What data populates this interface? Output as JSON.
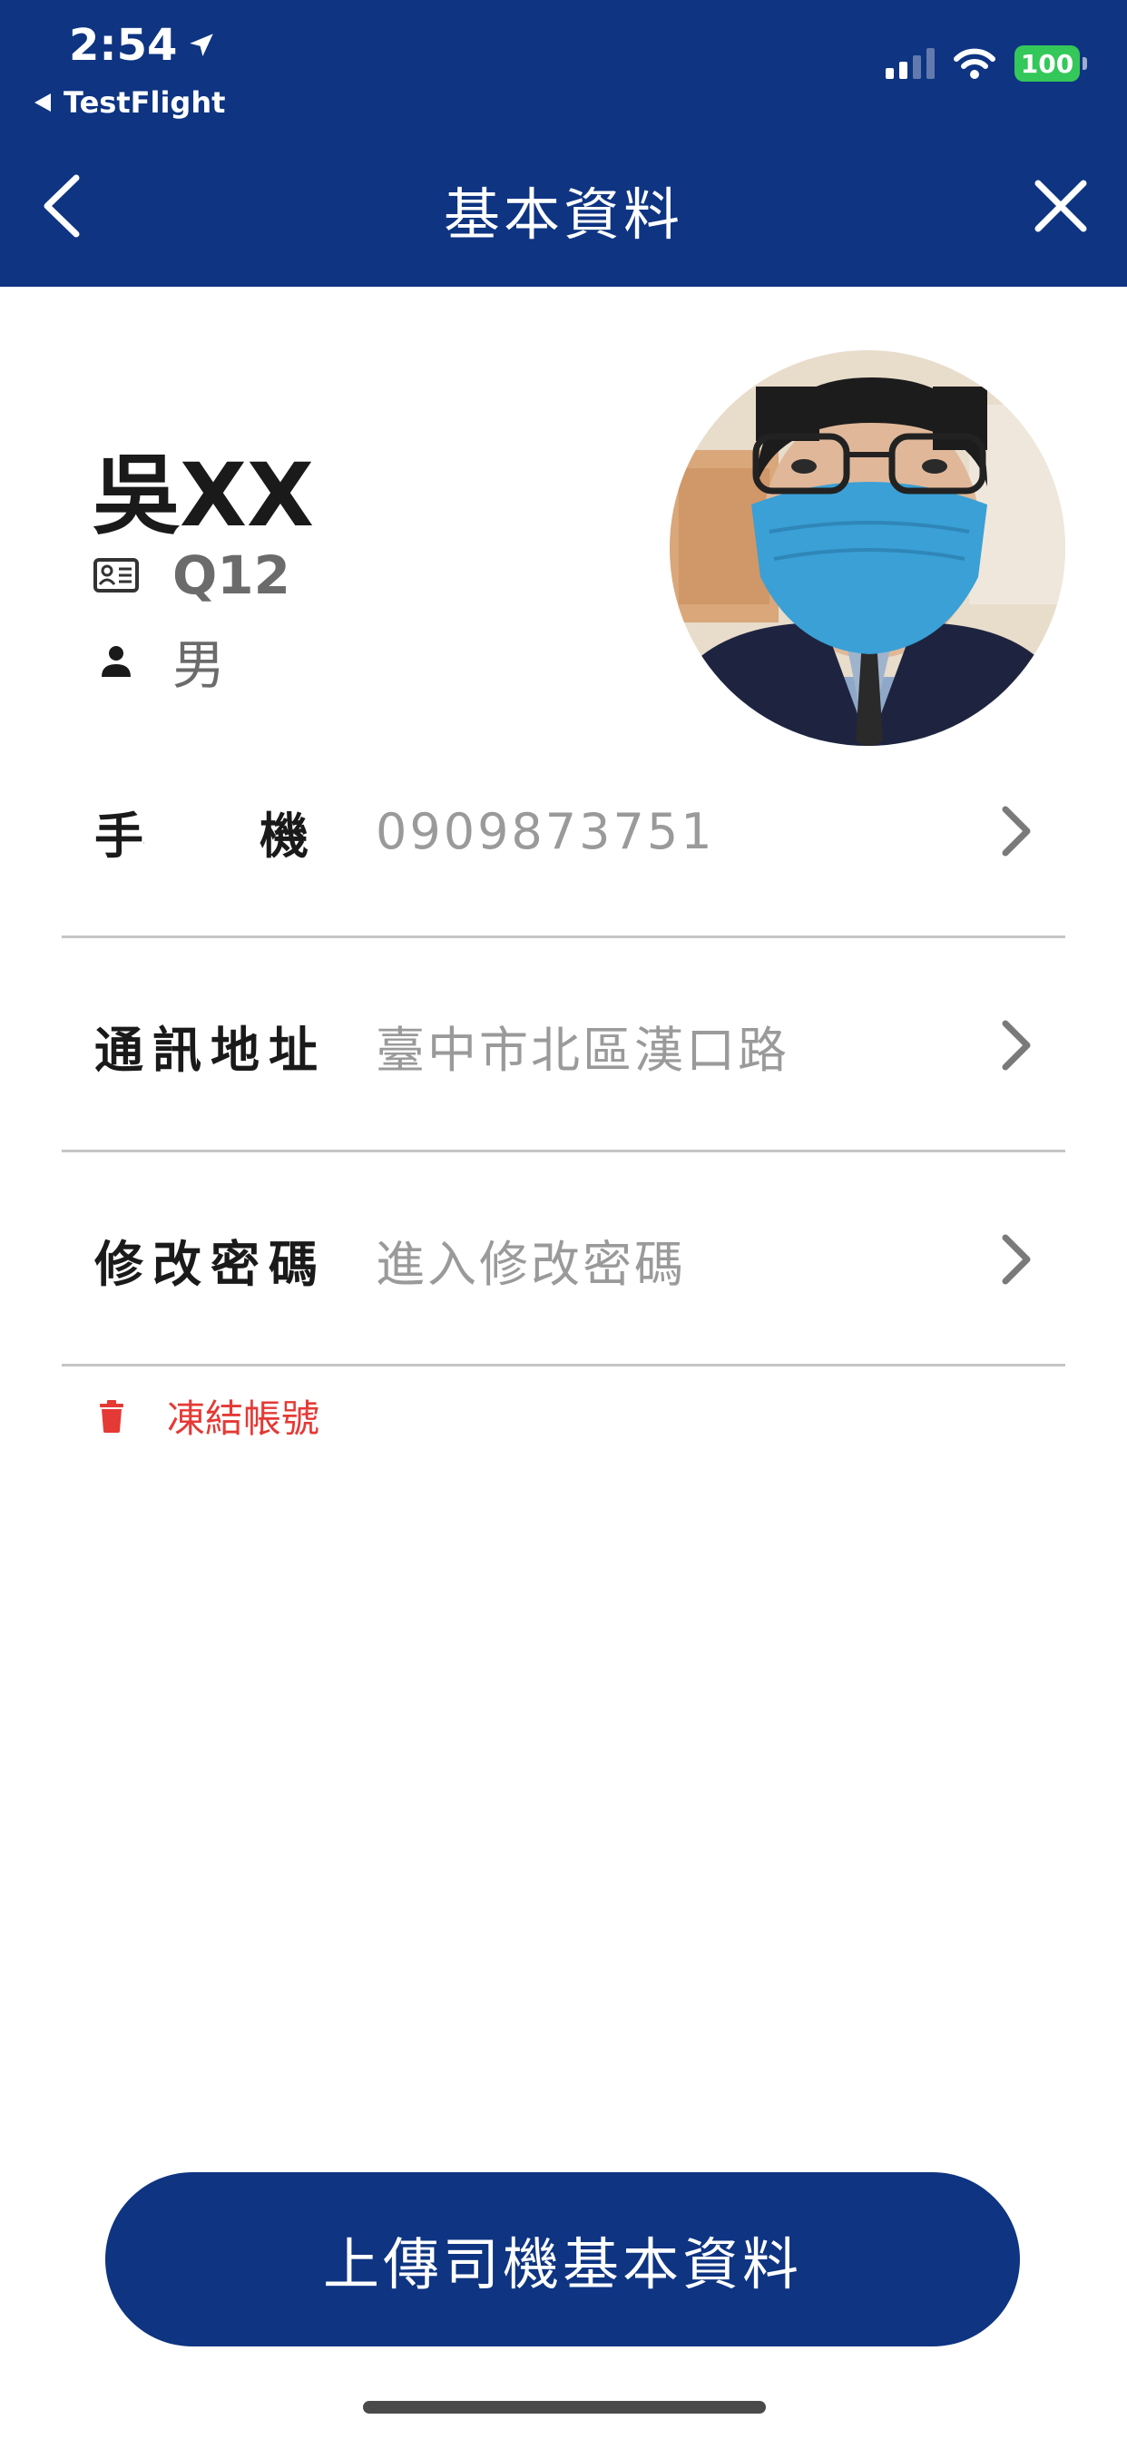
{
  "status_bar": {
    "time": "2:54",
    "back_app": "TestFlight",
    "battery": "100"
  },
  "nav": {
    "title": "基本資料"
  },
  "profile": {
    "name": "吳XX",
    "id_code": "Q12",
    "gender": "男"
  },
  "rows": [
    {
      "label": "手機",
      "value": "0909873751"
    },
    {
      "label": "通訊地址",
      "value": "臺中市北區漢口路"
    },
    {
      "label": "修改密碼",
      "value": "進入修改密碼"
    }
  ],
  "freeze_account": {
    "label": "凍結帳號"
  },
  "upload_button": {
    "label": "上傳司機基本資料"
  },
  "colors": {
    "brand_navy": "#0e3482",
    "danger_red": "#e53935",
    "battery_green": "#34c759"
  }
}
